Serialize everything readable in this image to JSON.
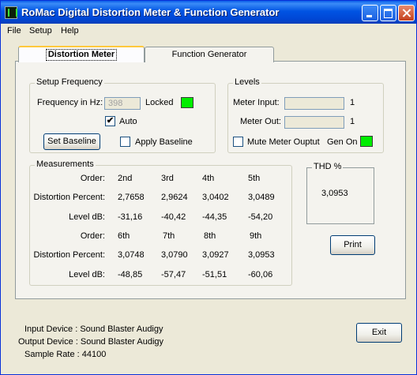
{
  "window": {
    "title": "RoMac Digital Distortion Meter & Function Generator"
  },
  "menu": [
    "File",
    "Setup",
    "Help"
  ],
  "tabs": [
    "Distortion Meter",
    "Function Generator"
  ],
  "setup": {
    "group_label": "Setup Frequency",
    "freq_label": "Frequency in Hz:",
    "freq_value": "398",
    "locked_label": "Locked",
    "auto_label": "Auto",
    "auto_checked": "✔",
    "set_baseline": "Set Baseline",
    "apply_baseline": "Apply Baseline",
    "locked_color": "#00ee00"
  },
  "levels": {
    "group_label": "Levels",
    "meter_input_label": "Meter Input:",
    "meter_input_value": "1",
    "meter_out_label": "Meter Out:",
    "meter_out_value": "1",
    "mute_label": "Mute Meter Ouptut",
    "gen_on_label": "Gen On",
    "gen_on_color": "#00ee00"
  },
  "measurements": {
    "group_label": "Measurements",
    "row_labels": {
      "order": "Order:",
      "distortion": "Distortion Percent:",
      "level": "Level dB:"
    },
    "block1": {
      "orders": [
        "2nd",
        "3rd",
        "4th",
        "5th"
      ],
      "distortion": [
        "2,7658",
        "2,9624",
        "3,0402",
        "3,0489"
      ],
      "level": [
        "-31,16",
        "-40,42",
        "-44,35",
        "-54,20"
      ]
    },
    "block2": {
      "orders": [
        "6th",
        "7th",
        "8th",
        "9th"
      ],
      "distortion": [
        "3,0748",
        "3,0790",
        "3,0927",
        "3,0953"
      ],
      "level": [
        "-48,85",
        "-57,47",
        "-51,51",
        "-60,06"
      ]
    }
  },
  "thd": {
    "label": "THD %",
    "value": "3,0953"
  },
  "print_button": "Print",
  "exit_button": "Exit",
  "status": {
    "input_device": "Input Device : Sound Blaster Audigy",
    "output_device": "Output Device : Sound Blaster Audigy",
    "sample_rate": "Sample Rate : 44100"
  }
}
